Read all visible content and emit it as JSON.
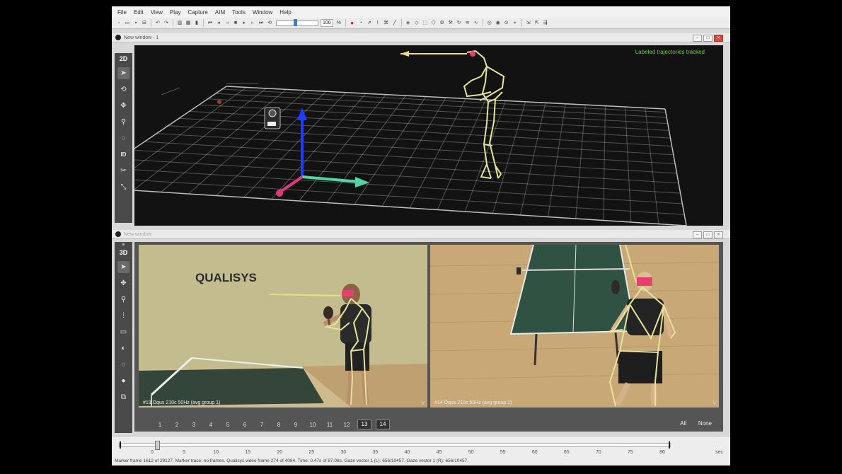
{
  "menu": [
    "File",
    "Edit",
    "View",
    "Play",
    "Capture",
    "AIM",
    "Tools",
    "Window",
    "Help"
  ],
  "toolbar": {
    "speed_value": "100"
  },
  "window3d": {
    "title": "New window - 1",
    "mode": "2D",
    "overlay": "Labeled trajectories tracked"
  },
  "window2d": {
    "title": "New window",
    "mode": "3D",
    "logo": "QUALISYS",
    "camera_left": "#13 Oqus 210c 50Hz (avg group 1)",
    "camera_right": "#14 Oqus 210c 50Hz (avg group 1)",
    "corner_mark": "V",
    "camera_numbers": [
      "1",
      "2",
      "3",
      "4",
      "5",
      "6",
      "7",
      "8",
      "9",
      "10",
      "11",
      "12",
      "13",
      "14"
    ],
    "selected_cameras": [
      "13",
      "14"
    ],
    "all_label": "All",
    "none_label": "None"
  },
  "side_tools": [
    "ID"
  ],
  "timeline": {
    "ticks": [
      "0",
      "5",
      "10",
      "15",
      "20",
      "25",
      "30",
      "35",
      "40",
      "45",
      "50",
      "55",
      "60",
      "65",
      "70",
      "75",
      "80"
    ],
    "unit": "sec",
    "status": "Marker frame 1612 of 28127. Marker trace: no frames. Qualisys video frame 274 of 4084. Time: 0.47s of 87.08s. Gaze vector 1 (L): 656/10457. Gaze vector 1 (R): 656/10457."
  },
  "colors": {
    "skeleton": "#e7e39a",
    "grid": "#cfcfcf",
    "axis_x": "#4fd6a3",
    "axis_y": "#1e3cff",
    "axis_z": "#e0387a",
    "overlay_text": "#6ecf3c",
    "marker": "#e8406e",
    "gaze": "#e8e080"
  }
}
